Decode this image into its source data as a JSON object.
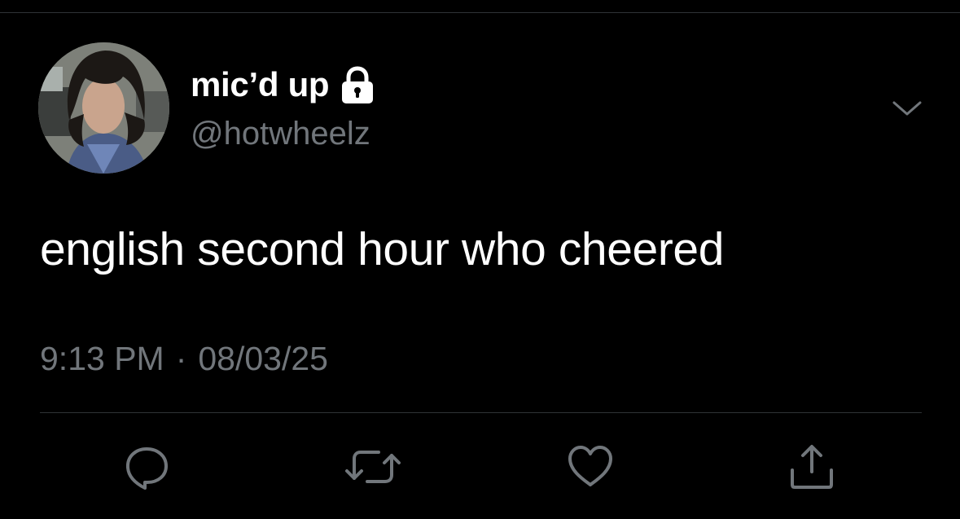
{
  "tweet": {
    "display_name": "mic’d up",
    "handle": "@hotwheelz",
    "protected_icon": "lock-icon",
    "text": "english second hour who cheered",
    "time": "9:13 PM",
    "separator": "·",
    "date": "08/03/25"
  },
  "actions": {
    "reply_icon": "speech-bubble-icon",
    "retweet_icon": "retweet-icon",
    "like_icon": "heart-icon",
    "share_icon": "share-icon",
    "more_icon": "chevron-down-icon"
  },
  "colors": {
    "background": "#000000",
    "primary_text": "#ffffff",
    "secondary_text": "#71767b",
    "divider": "#2f3336"
  }
}
